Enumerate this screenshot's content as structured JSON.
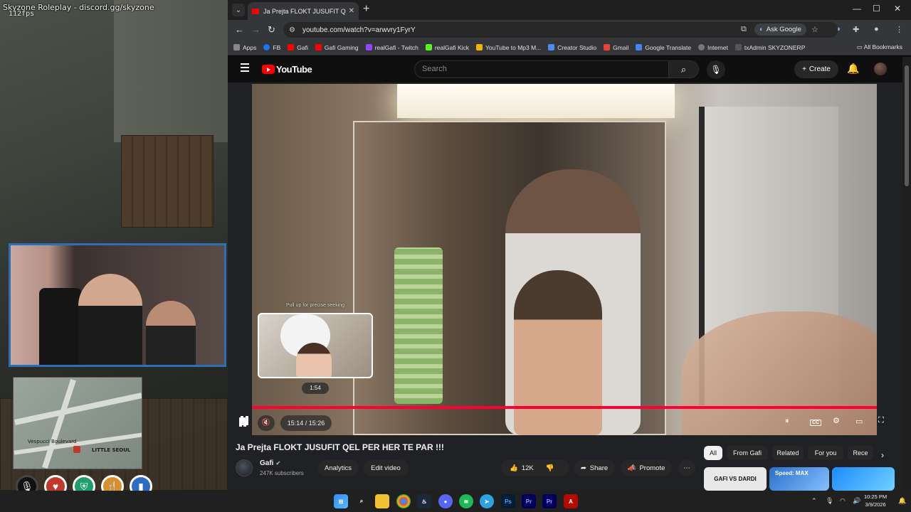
{
  "overlay": {
    "title": "Skyzone Roleplay - discord.gg/skyzone",
    "fps": "112fps"
  },
  "minimap": {
    "labels": [
      "Vespucci Boulevard",
      "LITTLE SEOUL"
    ]
  },
  "hud": {
    "icons": [
      "microphone-muted-icon",
      "heart-icon",
      "shield-icon",
      "food-icon",
      "water-icon"
    ]
  },
  "browser": {
    "tab_title": "Ja Prejta FLOKT JUSUFIT QEL PER HER TE PAR !!!",
    "url": "youtube.com/watch?v=arwvry1FyrY",
    "ask_google": "Ask Google",
    "bookmarks": [
      "Apps",
      "FB",
      "Gafi",
      "Gafi Gaming",
      "realGafi - Twitch",
      "realGafi Kick",
      "YouTube to Mp3 M...",
      "Creator Studio",
      "Gmail",
      "Google Translate",
      "Internet",
      "txAdmin SKYZONERP"
    ],
    "all_bookmarks": "All Bookmarks"
  },
  "youtube": {
    "logo_text": "YouTube",
    "search_placeholder": "Search",
    "create_label": "Create",
    "player": {
      "preview_tip": "Pull up for precise seeking",
      "preview_time": "1:54",
      "time_display": "15:14 / 15:26",
      "progress_fraction": 0.985,
      "hover_fraction": 0.123
    },
    "video_title": "Ja Prejta FLOKT JUSUFIT QEL PER HER TE PAR !!!",
    "channel": {
      "name": "Gafi",
      "subscribers": "247K subscribers"
    },
    "buttons": {
      "analytics": "Analytics",
      "edit_video": "Edit video",
      "likes": "12K",
      "share": "Share",
      "promote": "Promote"
    },
    "chips": [
      "All",
      "From Gafi",
      "Related",
      "For you",
      "Rece"
    ],
    "thumbnails": [
      "GAFI VS DARDI",
      "Speed: MAX",
      ""
    ]
  },
  "taskbar": {
    "clock_time": "10:25 PM",
    "clock_date": "3/9/2026",
    "apps": [
      "start-icon",
      "search-icon",
      "file-explorer-icon",
      "chrome-icon",
      "steam-icon",
      "discord-icon",
      "spotify-icon",
      "telegram-icon",
      "photoshop-icon",
      "premiere-icon",
      "premiere-icon-2",
      "acrobat-icon"
    ]
  },
  "colors": {
    "accent": "#ff0033",
    "webcam_border": "#2b6fb8",
    "youtube_bg": "#0f0f0f"
  }
}
